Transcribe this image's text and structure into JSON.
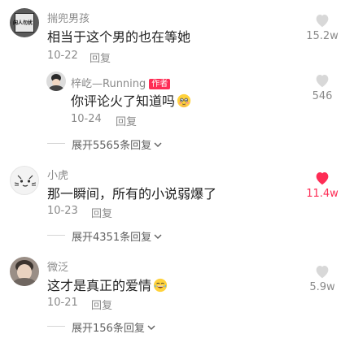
{
  "comments": [
    {
      "username": "揣兜男孩",
      "avatar_text": "闲人勿扰",
      "text": "相当于这个男的也在等她",
      "date": "10-22",
      "reply_label": "回复",
      "likes": "15.2w",
      "liked": false
    },
    {
      "username": "梓屹—Running",
      "author_badge": "作者",
      "text": "你评论火了知道吗",
      "emoji": "shy-face-emoji",
      "date": "10-24",
      "reply_label": "回复",
      "likes": "546",
      "liked": false,
      "is_reply": true
    },
    {
      "username": "小虎",
      "text": "那一瞬间，所有的小说弱爆了",
      "date": "10-23",
      "reply_label": "回复",
      "likes": "11.4w",
      "liked": true
    },
    {
      "username": "微泛",
      "text": "这才是真正的爱情",
      "emoji": "tears-of-joy-emoji",
      "date": "10-21",
      "reply_label": "回复",
      "likes": "5.9w",
      "liked": false
    }
  ],
  "expanders": [
    {
      "label": "展开5565条回复"
    },
    {
      "label": "展开4351条回复"
    },
    {
      "label": "展开156条回复"
    }
  ],
  "colors": {
    "accent": "#fe2c55",
    "secondary_text": "#8a8a8a"
  }
}
